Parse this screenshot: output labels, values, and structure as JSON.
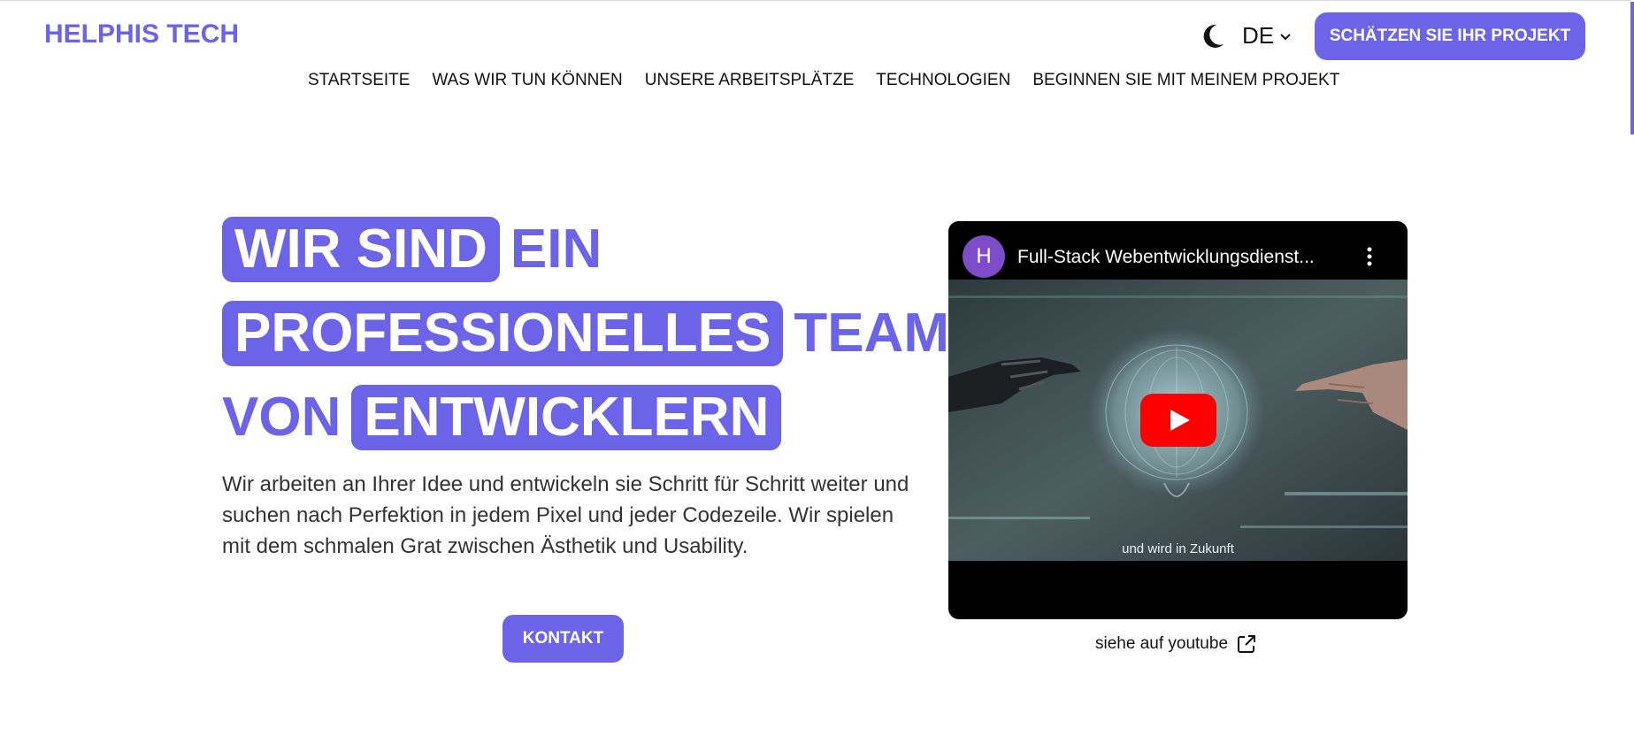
{
  "header": {
    "logo": "HELPHIS TECH",
    "lang": "DE",
    "cta_label": "SCHÄTZEN SIE IHR PROJEKT",
    "nav": [
      "STARTSEITE",
      "WAS WIR TUN KÖNNEN",
      "UNSERE ARBEITSPLÄTZE",
      "TECHNOLOGIEN",
      "BEGINNEN SIE MIT MEINEM PROJEKT"
    ]
  },
  "hero": {
    "line1_pill": "WIR SIND",
    "line1_plain": "EIN",
    "line2_pill": "PROFESSIONELLES",
    "line2_plain": "TEAM",
    "line3_plain": "VON",
    "line3_pill": "ENTWICKLERN",
    "description": "Wir arbeiten an Ihrer Idee und entwickeln sie Schritt für Schritt weiter und suchen nach Perfektion in jedem Pixel und jeder Codezeile. Wir spielen mit dem schmalen Grat zwischen Ästhetik und Usability.",
    "contact_label": "KONTAKT"
  },
  "video": {
    "channel_initial": "H",
    "title": "Full-Stack Webentwicklungsdienst...",
    "caption": "und wird in Zukunft",
    "watch_link": "siehe auf youtube"
  },
  "colors": {
    "accent": "#6b63e8",
    "youtube_red": "#ff0000"
  }
}
